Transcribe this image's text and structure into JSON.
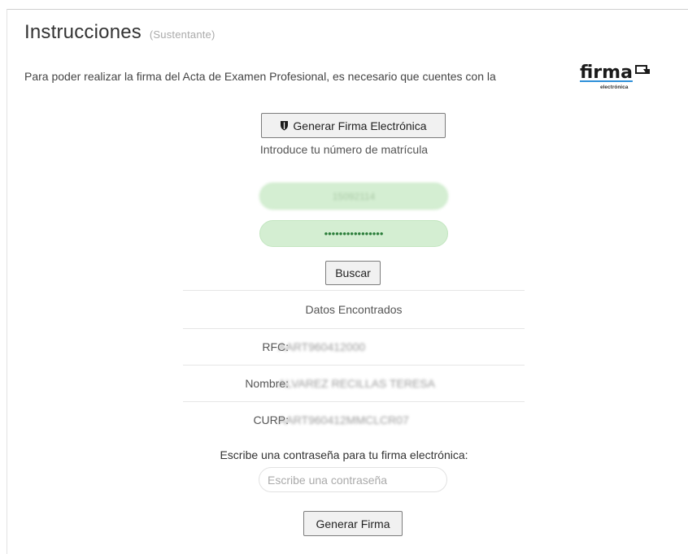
{
  "header": {
    "title": "Instrucciones",
    "subtitle": "(Sustentante)"
  },
  "intro_text": "Para poder realizar la firma del Acta de Examen Profesional, es necesario que cuentes con la",
  "logo": {
    "word": "firma",
    "small": "electrónica"
  },
  "generate_button": {
    "icon": "shield-icon",
    "label": "Generar Firma Electrónica"
  },
  "matricula_caption": "Introduce tu número de matrícula",
  "matricula_field": {
    "value": "15092114"
  },
  "password_field": {
    "value": "••••••••••••••••"
  },
  "search_button": {
    "label": "Buscar"
  },
  "results": {
    "heading": "Datos Encontrados",
    "rows": [
      {
        "label": "RFC:",
        "value": "AART960412000"
      },
      {
        "label": "Nombre:",
        "value": "ALVAREZ RECILLAS TERESA"
      },
      {
        "label": "CURP:",
        "value": "AART960412MMCLCR07"
      }
    ]
  },
  "signature_password": {
    "label": "Escribe una contraseña para tu firma electrónica:",
    "placeholder": "Escribe una contraseña"
  },
  "final_button": {
    "label": "Generar Firma"
  },
  "colors": {
    "pill_bg": "#d4eed2",
    "pill_text": "#2e7d32",
    "logo_underline": "#2e8fd8"
  }
}
